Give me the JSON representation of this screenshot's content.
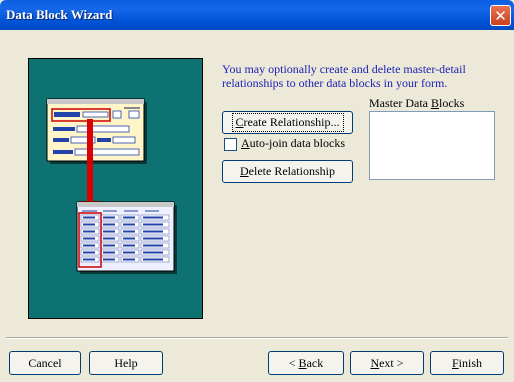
{
  "window": {
    "title": "Data Block Wizard"
  },
  "description": "You may optionally create and delete master-detail relationships to other data blocks in your form.",
  "buttons": {
    "create_relationship": {
      "pre": "",
      "accel": "C",
      "post": "reate Relationship..."
    },
    "delete_relationship": {
      "pre": "",
      "accel": "D",
      "post": "elete Relationship"
    },
    "cancel": "Cancel",
    "help": "Help",
    "back": {
      "pre": "< ",
      "accel": "B",
      "post": "ack"
    },
    "next": {
      "pre": "",
      "accel": "N",
      "post": "ext >"
    },
    "finish": {
      "pre": "",
      "accel": "F",
      "post": "inish"
    }
  },
  "auto_join": {
    "pre": "",
    "accel": "A",
    "post": "uto-join data blocks",
    "checked": false
  },
  "master_blocks": {
    "pre": "Master Data ",
    "accel": "B",
    "post": "locks",
    "items": []
  },
  "icons": {
    "close": "close-icon",
    "illustration": "master-detail-illustration"
  },
  "colors": {
    "illustration_bg": "#0F7272",
    "description_text": "#1E22B4",
    "titlebar": "#0054E3",
    "arrow": "#DD0000"
  }
}
